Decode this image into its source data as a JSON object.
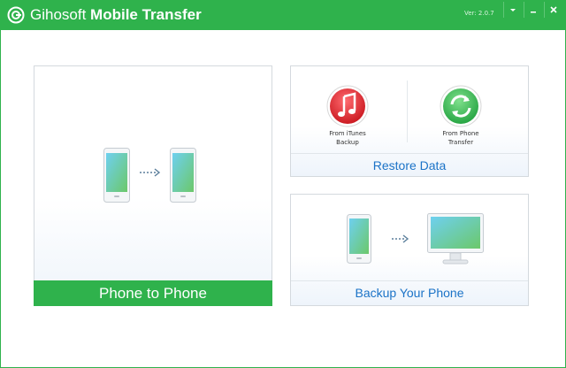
{
  "window": {
    "brand": "Gihosoft",
    "product": "Mobile Transfer",
    "version": "Ver: 2.0.7"
  },
  "titlebar_buttons": [
    "dropdown-menu",
    "minimize",
    "close"
  ],
  "panels": {
    "phone_to_phone": {
      "label": "Phone to Phone"
    },
    "restore_data": {
      "label": "Restore Data",
      "options": [
        {
          "label": "From iTunes\nBackup",
          "icon": "itunes-icon"
        },
        {
          "label": "From Phone\nTransfer",
          "icon": "sync-icon"
        }
      ]
    },
    "backup_phone": {
      "label": "Backup Your Phone"
    }
  },
  "colors": {
    "accent_green": "#2fb24c",
    "link_blue": "#1b73c7",
    "itunes_red": "#e0262d"
  }
}
